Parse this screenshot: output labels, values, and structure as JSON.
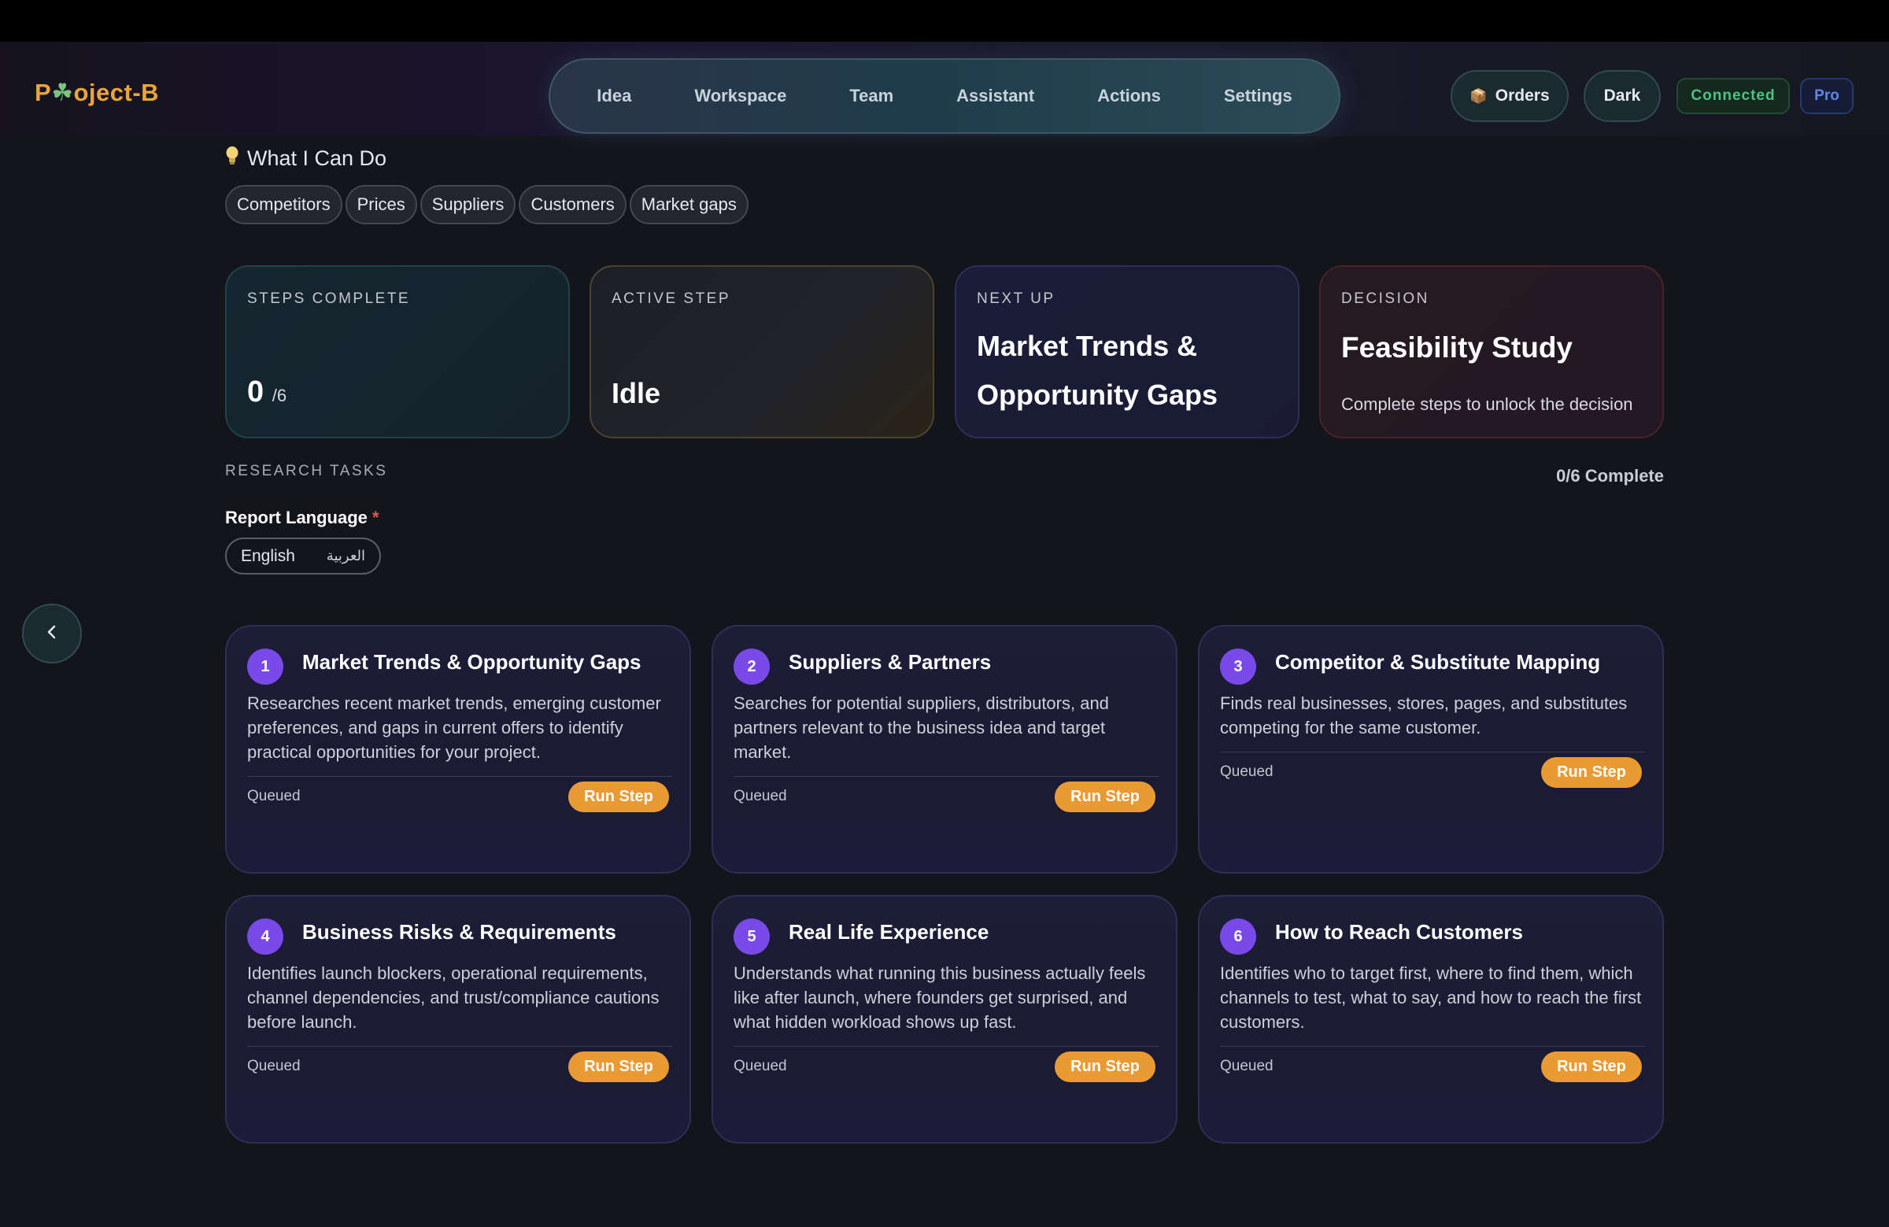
{
  "app": {
    "logo_pre": "P",
    "logo_leaf": "☘",
    "logo_post": "oject-B",
    "brand_color": "#e9a53a"
  },
  "nav": {
    "items": [
      {
        "label": "Idea"
      },
      {
        "label": "Workspace"
      },
      {
        "label": "Team"
      },
      {
        "label": "Assistant"
      },
      {
        "label": "Actions"
      },
      {
        "label": "Settings"
      }
    ]
  },
  "header_actions": {
    "orders_icon": "📦",
    "orders_label": "Orders",
    "theme_label": "Dark",
    "connection_status": "Connected",
    "plan_badge": "Pro"
  },
  "capabilities": {
    "icon": "lightbulb-icon",
    "title": "What I Can Do",
    "chips": [
      "Competitors",
      "Prices",
      "Suppliers",
      "Customers",
      "Market gaps"
    ]
  },
  "stats": {
    "steps_complete": {
      "label": "STEPS COMPLETE",
      "value": "0",
      "total": "/6"
    },
    "active_step": {
      "label": "ACTIVE STEP",
      "value": "Idle"
    },
    "next_up": {
      "label": "NEXT UP",
      "value": "Market Trends & Opportunity Gaps"
    },
    "decision": {
      "label": "DECISION",
      "value": "Feasibility Study",
      "sub": "Complete steps to unlock the decision"
    }
  },
  "research": {
    "label": "RESEARCH TASKS",
    "progress": "0/6 Complete",
    "language_label": "Report Language",
    "required_mark": "*",
    "language_options": [
      "English",
      "العربية"
    ],
    "selected_language": "English"
  },
  "tasks": [
    {
      "num": "1",
      "title": "Market Trends & Opportunity Gaps",
      "desc": "Researches recent market trends, emerging customer preferences, and gaps in current offers to identify practical opportunities for your project.",
      "status": "Queued",
      "action": "Run Step"
    },
    {
      "num": "2",
      "title": "Suppliers & Partners",
      "desc": "Searches for potential suppliers, distributors, and partners relevant to the business idea and target market.",
      "status": "Queued",
      "action": "Run Step"
    },
    {
      "num": "3",
      "title": "Competitor & Substitute Mapping",
      "desc": "Finds real businesses, stores, pages, and substitutes competing for the same customer.",
      "status": "Queued",
      "action": "Run Step"
    },
    {
      "num": "4",
      "title": "Business Risks & Requirements",
      "desc": "Identifies launch blockers, operational requirements, channel dependencies, and trust/compliance cautions before launch.",
      "status": "Queued",
      "action": "Run Step"
    },
    {
      "num": "5",
      "title": "Real Life Experience",
      "desc": "Understands what running this business actually feels like after launch, where founders get surprised, and what hidden workload shows up fast.",
      "status": "Queued",
      "action": "Run Step"
    },
    {
      "num": "6",
      "title": "How to Reach Customers",
      "desc": "Identifies who to target first, where to find them, which channels to test, what to say, and how to reach the first customers.",
      "status": "Queued",
      "action": "Run Step"
    }
  ],
  "colors": {
    "accent_orange": "#e99a32",
    "step_purple": "#7a4ae8",
    "connected_green": "#4cc47d",
    "pro_blue": "#5f86e8"
  }
}
